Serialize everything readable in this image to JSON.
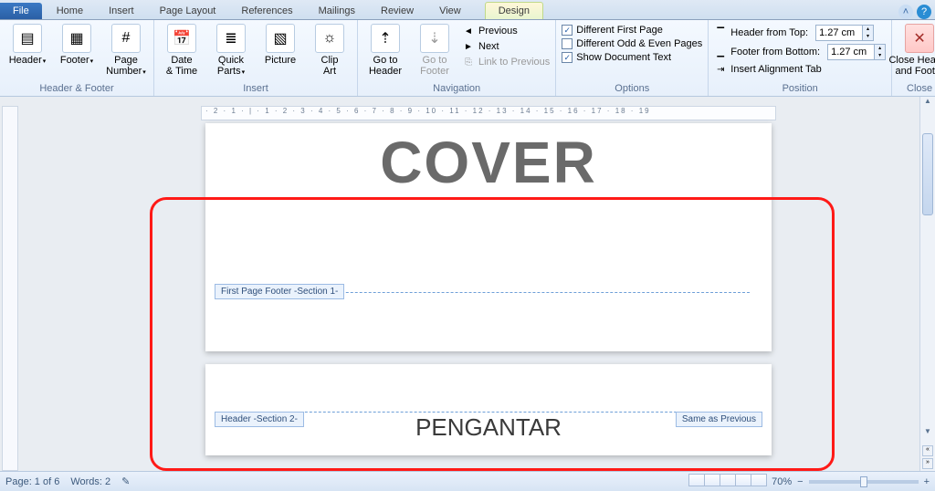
{
  "tabs": {
    "file": "File",
    "items": [
      "Home",
      "Insert",
      "Page Layout",
      "References",
      "Mailings",
      "Review",
      "View"
    ],
    "contextual": "Design"
  },
  "ribbon": {
    "header_footer": {
      "label": "Header & Footer",
      "header": "Header",
      "footer": "Footer",
      "page_number": "Page\nNumber"
    },
    "insert": {
      "label": "Insert",
      "date": "Date\n& Time",
      "quick": "Quick\nParts",
      "picture": "Picture",
      "clip": "Clip\nArt"
    },
    "navigation": {
      "label": "Navigation",
      "goto_header": "Go to\nHeader",
      "goto_footer": "Go to\nFooter",
      "previous": "Previous",
      "next": "Next",
      "link": "Link to Previous"
    },
    "options": {
      "label": "Options",
      "diff_first": "Different First Page",
      "diff_odd": "Different Odd & Even Pages",
      "show_doc": "Show Document Text"
    },
    "position": {
      "label": "Position",
      "from_top": "Header from Top:",
      "from_bottom": "Footer from Bottom:",
      "align_tab": "Insert Alignment Tab",
      "top_val": "1.27 cm",
      "bot_val": "1.27 cm"
    },
    "close": {
      "label": "Close",
      "btn": "Close Header\nand Footer"
    }
  },
  "ruler": "· 2 · 1 · | · 1 · 2 · 3 · 4 · 5 · 6 · 7 · 8 · 9 · 10 · 11 · 12 · 13 · 14 · 15 · 16 · 17 · 18 · 19",
  "doc": {
    "cover": "COVER",
    "footer_tag": "First Page Footer -Section 1-",
    "header_tag": "Header -Section 2-",
    "same_prev": "Same as Previous",
    "pengantar": "PENGANTAR"
  },
  "status": {
    "page": "Page: 1 of 6",
    "words": "Words: 2",
    "zoom": "70%"
  }
}
